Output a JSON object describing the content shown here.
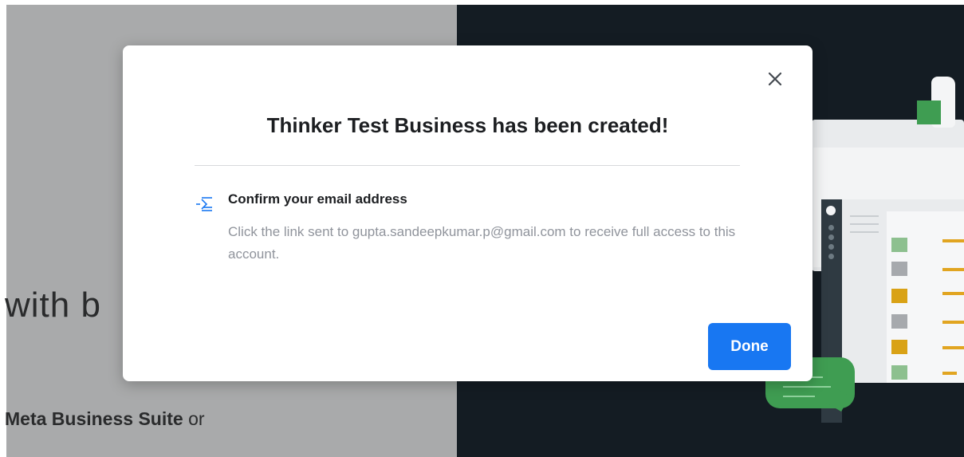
{
  "background": {
    "hero_partial_text": "with b",
    "hero_sub_strong": "Meta Business Suite",
    "hero_sub_rest": " or"
  },
  "modal": {
    "title": "Thinker Test Business has been created!",
    "notice": {
      "icon": "email-lines-icon",
      "heading": "Confirm your email address",
      "body": "Click the link sent to gupta.sandeepkumar.p@gmail.com to receive full access to this account."
    },
    "close_icon": "close-icon",
    "done_label": "Done"
  },
  "colors": {
    "primary": "#1877f2",
    "left_background": "#a9aaab",
    "right_background": "#141c23",
    "muted_text": "#90949c",
    "illustration_green": "#3f9d52",
    "illustration_yellow": "#e1a521"
  }
}
